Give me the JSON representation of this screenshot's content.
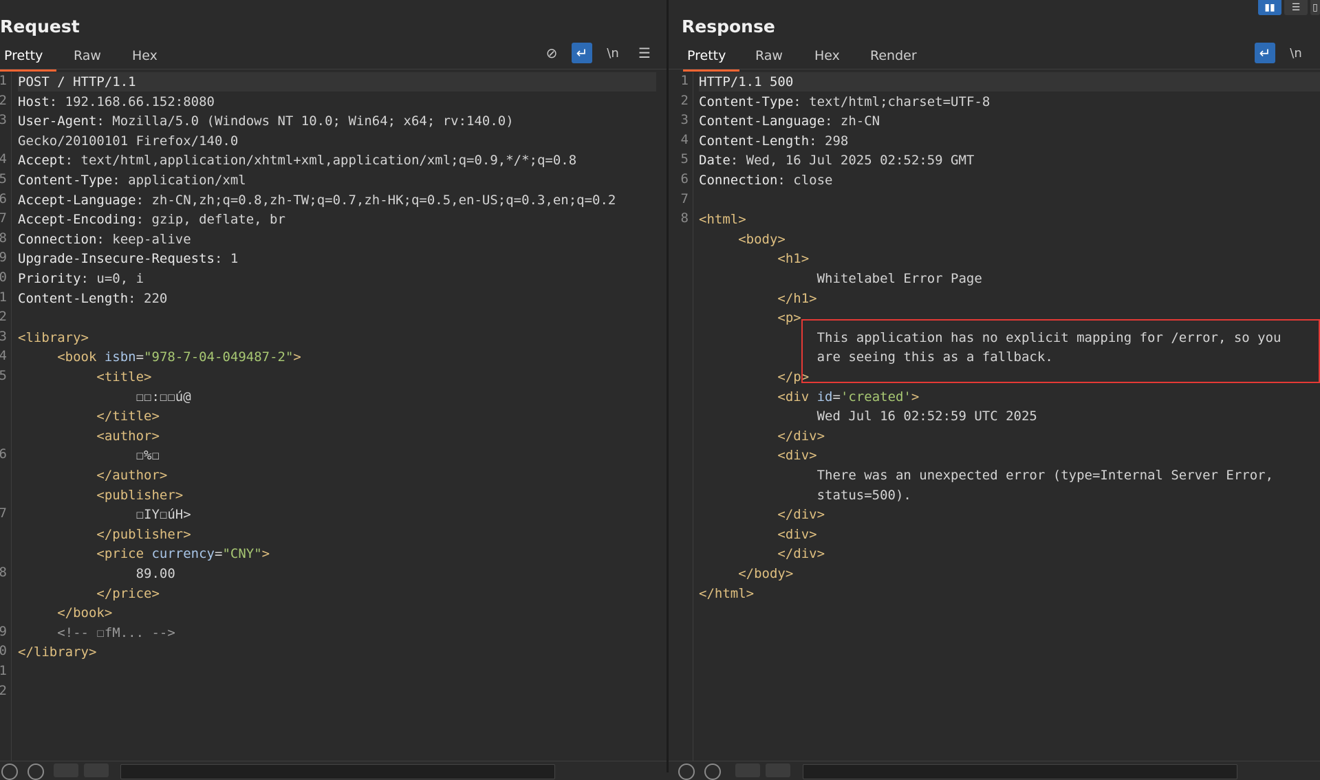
{
  "layout_buttons": [
    {
      "icon": "split-horizontal-icon",
      "glyph": "▮▮"
    },
    {
      "icon": "split-vertical-icon",
      "glyph": "☰"
    },
    {
      "icon": "tabs-layout-icon",
      "glyph": "▯"
    }
  ],
  "request": {
    "title": "Request",
    "tabs": [
      "Pretty",
      "Raw",
      "Hex"
    ],
    "active_tab": "Pretty",
    "tools": [
      {
        "icon": "hide-icon",
        "glyph": "⊘"
      },
      {
        "icon": "word-wrap-icon",
        "glyph": "↵"
      },
      {
        "icon": "newline-icon",
        "glyph": "\\n"
      },
      {
        "icon": "menu-icon",
        "glyph": "☰"
      }
    ],
    "line_numbers": [
      "1",
      "2",
      "3",
      "",
      "4",
      "5",
      "6",
      "7",
      "8",
      "9",
      "0",
      "1",
      "2",
      "3",
      "4",
      "5",
      "",
      "",
      "",
      "6",
      "",
      "",
      "7",
      "",
      "",
      "8",
      "",
      "",
      "9",
      "0",
      "1",
      "2"
    ],
    "lines": [
      [
        {
          "t": "k",
          "v": "POST / HTTP/1.1"
        }
      ],
      [
        {
          "t": "k",
          "v": "Host"
        },
        {
          "t": "",
          "v": ": 192.168.66.152:8080"
        }
      ],
      [
        {
          "t": "k",
          "v": "User-Agent"
        },
        {
          "t": "",
          "v": ": Mozilla/5.0 (Windows NT 10.0; Win64; x64; rv:140.0)"
        }
      ],
      [
        {
          "t": "",
          "v": "Gecko/20100101 Firefox/140.0"
        }
      ],
      [
        {
          "t": "k",
          "v": "Accept"
        },
        {
          "t": "",
          "v": ": text/html,application/xhtml+xml,application/xml;q=0.9,*/*;q=0.8"
        }
      ],
      [
        {
          "t": "k",
          "v": "Content-Type"
        },
        {
          "t": "",
          "v": ": application/xml"
        }
      ],
      [
        {
          "t": "k",
          "v": "Accept-Language"
        },
        {
          "t": "",
          "v": ": zh-CN,zh;q=0.8,zh-TW;q=0.7,zh-HK;q=0.5,en-US;q=0.3,en;q=0.2"
        }
      ],
      [
        {
          "t": "k",
          "v": "Accept-Encoding"
        },
        {
          "t": "",
          "v": ": gzip, deflate, br"
        }
      ],
      [
        {
          "t": "k",
          "v": "Connection"
        },
        {
          "t": "",
          "v": ": keep-alive"
        }
      ],
      [
        {
          "t": "k",
          "v": "Upgrade-Insecure-Requests"
        },
        {
          "t": "",
          "v": ": 1"
        }
      ],
      [
        {
          "t": "k",
          "v": "Priority"
        },
        {
          "t": "",
          "v": ": u=0, i"
        }
      ],
      [
        {
          "t": "k",
          "v": "Content-Length"
        },
        {
          "t": "",
          "v": ": 220"
        }
      ],
      [],
      [
        {
          "t": "tag",
          "v": "<library>"
        }
      ],
      [
        {
          "t": "",
          "v": "     "
        },
        {
          "t": "tag",
          "v": "<book "
        },
        {
          "t": "attr",
          "v": "isbn"
        },
        {
          "t": "",
          "v": "="
        },
        {
          "t": "str",
          "v": "\"978-7-04-049487-2\""
        },
        {
          "t": "tag",
          "v": ">"
        }
      ],
      [
        {
          "t": "",
          "v": "          "
        },
        {
          "t": "tag",
          "v": "<title>"
        }
      ],
      [
        {
          "t": "",
          "v": "               ☐☐:☐☐ú@"
        }
      ],
      [
        {
          "t": "",
          "v": "          "
        },
        {
          "t": "tag",
          "v": "</title>"
        }
      ],
      [
        {
          "t": "",
          "v": "          "
        },
        {
          "t": "tag",
          "v": "<author>"
        }
      ],
      [
        {
          "t": "",
          "v": "               ☐%☐"
        }
      ],
      [
        {
          "t": "",
          "v": "          "
        },
        {
          "t": "tag",
          "v": "</author>"
        }
      ],
      [
        {
          "t": "",
          "v": "          "
        },
        {
          "t": "tag",
          "v": "<publisher>"
        }
      ],
      [
        {
          "t": "",
          "v": "               ☐IY☐úH>"
        }
      ],
      [
        {
          "t": "",
          "v": "          "
        },
        {
          "t": "tag",
          "v": "</publisher>"
        }
      ],
      [
        {
          "t": "",
          "v": "          "
        },
        {
          "t": "tag",
          "v": "<price "
        },
        {
          "t": "attr",
          "v": "currency"
        },
        {
          "t": "",
          "v": "="
        },
        {
          "t": "str",
          "v": "\"CNY\""
        },
        {
          "t": "tag",
          "v": ">"
        }
      ],
      [
        {
          "t": "",
          "v": "               89.00"
        }
      ],
      [
        {
          "t": "",
          "v": "          "
        },
        {
          "t": "tag",
          "v": "</price>"
        }
      ],
      [
        {
          "t": "",
          "v": "     "
        },
        {
          "t": "tag",
          "v": "</book>"
        }
      ],
      [
        {
          "t": "",
          "v": "     "
        },
        {
          "t": "cmt",
          "v": "<!-- ☐fM... -->"
        }
      ],
      [
        {
          "t": "tag",
          "v": "</library>"
        }
      ],
      []
    ]
  },
  "response": {
    "title": "Response",
    "tabs": [
      "Pretty",
      "Raw",
      "Hex",
      "Render"
    ],
    "active_tab": "Pretty",
    "tools": [
      {
        "icon": "word-wrap-icon",
        "glyph": "↵"
      },
      {
        "icon": "newline-icon",
        "glyph": "\\n"
      }
    ],
    "line_numbers": [
      "1",
      "2",
      "3",
      "4",
      "5",
      "6",
      "7",
      "8"
    ],
    "lines": [
      [
        {
          "t": "k",
          "v": "HTTP/1.1 500"
        }
      ],
      [
        {
          "t": "k",
          "v": "Content-Type"
        },
        {
          "t": "",
          "v": ": text/html;charset=UTF-8"
        }
      ],
      [
        {
          "t": "k",
          "v": "Content-Language"
        },
        {
          "t": "",
          "v": ": zh-CN"
        }
      ],
      [
        {
          "t": "k",
          "v": "Content-Length"
        },
        {
          "t": "",
          "v": ": 298"
        }
      ],
      [
        {
          "t": "k",
          "v": "Date"
        },
        {
          "t": "",
          "v": ": Wed, 16 Jul 2025 02:52:59 GMT"
        }
      ],
      [
        {
          "t": "k",
          "v": "Connection"
        },
        {
          "t": "",
          "v": ": close"
        }
      ],
      [],
      [
        {
          "t": "tag",
          "v": "<html>"
        }
      ],
      [
        {
          "t": "",
          "v": "     "
        },
        {
          "t": "tag",
          "v": "<body>"
        }
      ],
      [
        {
          "t": "",
          "v": "          "
        },
        {
          "t": "tag",
          "v": "<h1>"
        }
      ],
      [
        {
          "t": "",
          "v": "               Whitelabel Error Page"
        }
      ],
      [
        {
          "t": "",
          "v": "          "
        },
        {
          "t": "tag",
          "v": "</h1>"
        }
      ],
      [
        {
          "t": "",
          "v": "          "
        },
        {
          "t": "tag",
          "v": "<p>"
        }
      ],
      [
        {
          "t": "",
          "v": "               This application has no explicit mapping for /error, so you"
        }
      ],
      [
        {
          "t": "",
          "v": "               are seeing this as a fallback."
        }
      ],
      [
        {
          "t": "",
          "v": "          "
        },
        {
          "t": "tag",
          "v": "</p>"
        }
      ],
      [
        {
          "t": "",
          "v": "          "
        },
        {
          "t": "tag",
          "v": "<div "
        },
        {
          "t": "attr",
          "v": "id"
        },
        {
          "t": "",
          "v": "="
        },
        {
          "t": "str",
          "v": "'created'"
        },
        {
          "t": "tag",
          "v": ">"
        }
      ],
      [
        {
          "t": "",
          "v": "               Wed Jul 16 02:52:59 UTC 2025"
        }
      ],
      [
        {
          "t": "",
          "v": "          "
        },
        {
          "t": "tag",
          "v": "</div>"
        }
      ],
      [
        {
          "t": "",
          "v": "          "
        },
        {
          "t": "tag",
          "v": "<div>"
        }
      ],
      [
        {
          "t": "",
          "v": "               There was an unexpected error (type=Internal Server Error,"
        }
      ],
      [
        {
          "t": "",
          "v": "               status=500)."
        }
      ],
      [
        {
          "t": "",
          "v": "          "
        },
        {
          "t": "tag",
          "v": "</div>"
        }
      ],
      [
        {
          "t": "",
          "v": "          "
        },
        {
          "t": "tag",
          "v": "<div>"
        }
      ],
      [
        {
          "t": "",
          "v": "          "
        },
        {
          "t": "tag",
          "v": "</div>"
        }
      ],
      [
        {
          "t": "",
          "v": "     "
        },
        {
          "t": "tag",
          "v": "</body>"
        }
      ],
      [
        {
          "t": "tag",
          "v": "</html>"
        }
      ]
    ]
  }
}
